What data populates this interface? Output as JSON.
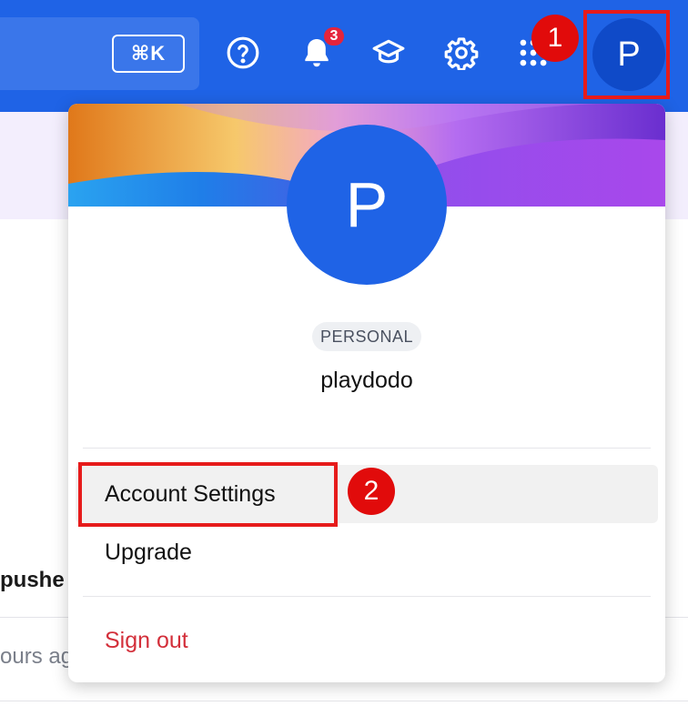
{
  "topbar": {
    "search_shortcut": "⌘K",
    "icons": [
      "help-icon",
      "bell-icon",
      "graduation-cap-icon",
      "gear-icon",
      "apps-grid-icon"
    ],
    "notification_count": "3",
    "avatar_initial": "P"
  },
  "annotations": {
    "step_1": "1",
    "step_2": "2"
  },
  "background": {
    "text_1": "pushe",
    "text_2": "ours ag"
  },
  "menu": {
    "avatar_initial": "P",
    "plan": "PERSONAL",
    "username": "playdodo",
    "items": [
      {
        "label": "Account Settings"
      },
      {
        "label": "Upgrade"
      }
    ],
    "signout_label": "Sign out"
  },
  "colors": {
    "topbar": "#1f63e6",
    "avatar": "#1f63e6",
    "badge": "#e5243b",
    "annotation": "#e61b1b",
    "signout": "#d32f3a"
  }
}
